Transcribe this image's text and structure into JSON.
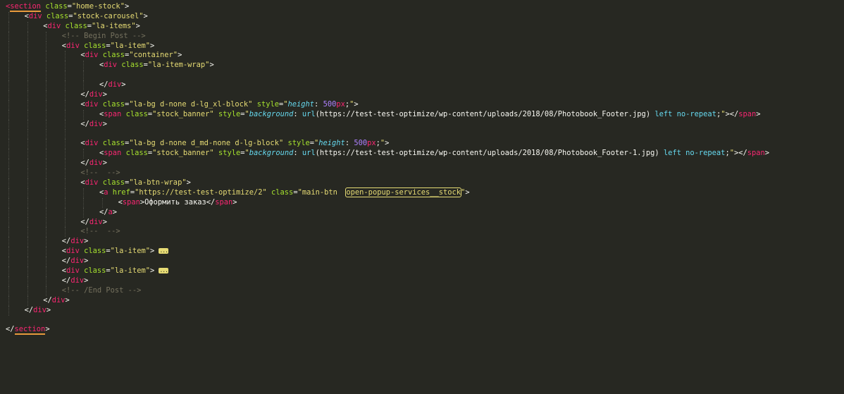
{
  "lines": [
    {
      "indent": 0,
      "tokens": [
        {
          "t": "tag",
          "v": "<"
        },
        {
          "t": "tag",
          "v": "section",
          "u": true
        },
        {
          "t": "text",
          "v": " "
        },
        {
          "t": "attr",
          "v": "class"
        },
        {
          "t": "text",
          "v": "="
        },
        {
          "t": "str",
          "v": "\"home-stock\""
        },
        {
          "t": "text",
          "v": ">"
        }
      ]
    },
    {
      "indent": 1,
      "tokens": [
        {
          "t": "text",
          "v": "<"
        },
        {
          "t": "tag",
          "v": "div"
        },
        {
          "t": "text",
          "v": " "
        },
        {
          "t": "attr",
          "v": "class"
        },
        {
          "t": "text",
          "v": "="
        },
        {
          "t": "str",
          "v": "\"stock-carousel\""
        },
        {
          "t": "text",
          "v": ">"
        }
      ]
    },
    {
      "indent": 2,
      "tokens": [
        {
          "t": "text",
          "v": "<"
        },
        {
          "t": "tag",
          "v": "div"
        },
        {
          "t": "text",
          "v": " "
        },
        {
          "t": "attr",
          "v": "class"
        },
        {
          "t": "text",
          "v": "="
        },
        {
          "t": "str",
          "v": "\"la-items\""
        },
        {
          "t": "text",
          "v": ">"
        }
      ]
    },
    {
      "indent": 3,
      "tokens": [
        {
          "t": "comment",
          "v": "<!-- Begin Post -->"
        }
      ]
    },
    {
      "indent": 3,
      "tokens": [
        {
          "t": "text",
          "v": "<"
        },
        {
          "t": "tag",
          "v": "div"
        },
        {
          "t": "text",
          "v": " "
        },
        {
          "t": "attr",
          "v": "class"
        },
        {
          "t": "text",
          "v": "="
        },
        {
          "t": "str",
          "v": "\"la-item\""
        },
        {
          "t": "text",
          "v": ">"
        }
      ]
    },
    {
      "indent": 4,
      "tokens": [
        {
          "t": "text",
          "v": "<"
        },
        {
          "t": "tag",
          "v": "div"
        },
        {
          "t": "text",
          "v": " "
        },
        {
          "t": "attr",
          "v": "class"
        },
        {
          "t": "text",
          "v": "="
        },
        {
          "t": "str",
          "v": "\"container\""
        },
        {
          "t": "text",
          "v": ">"
        }
      ]
    },
    {
      "indent": 5,
      "tokens": [
        {
          "t": "text",
          "v": "<"
        },
        {
          "t": "tag",
          "v": "div"
        },
        {
          "t": "text",
          "v": " "
        },
        {
          "t": "attr",
          "v": "class"
        },
        {
          "t": "text",
          "v": "="
        },
        {
          "t": "str",
          "v": "\"la-item-wrap\""
        },
        {
          "t": "text",
          "v": ">"
        }
      ]
    },
    {
      "indent": 5,
      "tokens": []
    },
    {
      "indent": 5,
      "tokens": [
        {
          "t": "text",
          "v": "</"
        },
        {
          "t": "tag",
          "v": "div"
        },
        {
          "t": "text",
          "v": ">"
        }
      ]
    },
    {
      "indent": 4,
      "tokens": [
        {
          "t": "text",
          "v": "</"
        },
        {
          "t": "tag",
          "v": "div"
        },
        {
          "t": "text",
          "v": ">"
        }
      ]
    },
    {
      "indent": 4,
      "tokens": [
        {
          "t": "text",
          "v": "<"
        },
        {
          "t": "tag",
          "v": "div"
        },
        {
          "t": "text",
          "v": " "
        },
        {
          "t": "attr",
          "v": "class"
        },
        {
          "t": "text",
          "v": "="
        },
        {
          "t": "str",
          "v": "\"la-bg d-none d-lg_xl-block\""
        },
        {
          "t": "text",
          "v": " "
        },
        {
          "t": "attr",
          "v": "style"
        },
        {
          "t": "text",
          "v": "="
        },
        {
          "t": "str",
          "v": "\""
        },
        {
          "t": "prop",
          "v": "height"
        },
        {
          "t": "text",
          "v": ": "
        },
        {
          "t": "num",
          "v": "500"
        },
        {
          "t": "unit",
          "v": "px"
        },
        {
          "t": "text",
          "v": ";"
        },
        {
          "t": "str",
          "v": "\""
        },
        {
          "t": "text",
          "v": ">"
        }
      ]
    },
    {
      "indent": 5,
      "tokens": [
        {
          "t": "text",
          "v": "<"
        },
        {
          "t": "tag",
          "v": "span"
        },
        {
          "t": "text",
          "v": " "
        },
        {
          "t": "attr",
          "v": "class"
        },
        {
          "t": "text",
          "v": "="
        },
        {
          "t": "str",
          "v": "\"stock_banner\""
        },
        {
          "t": "text",
          "v": " "
        },
        {
          "t": "attr",
          "v": "style"
        },
        {
          "t": "text",
          "v": "="
        },
        {
          "t": "str",
          "v": "\""
        },
        {
          "t": "prop",
          "v": "background"
        },
        {
          "t": "text",
          "v": ": "
        },
        {
          "t": "fn",
          "v": "url"
        },
        {
          "t": "text",
          "v": "(https://test-test-optimize/wp-content/uploads/2018/08/Photobook_Footer.jpg) "
        },
        {
          "t": "kw",
          "v": "left"
        },
        {
          "t": "text",
          "v": " "
        },
        {
          "t": "kw",
          "v": "no-repeat"
        },
        {
          "t": "text",
          "v": ";"
        },
        {
          "t": "str",
          "v": "\""
        },
        {
          "t": "text",
          "v": "></"
        },
        {
          "t": "tag",
          "v": "span"
        },
        {
          "t": "text",
          "v": ">"
        }
      ]
    },
    {
      "indent": 4,
      "tokens": [
        {
          "t": "text",
          "v": "</"
        },
        {
          "t": "tag",
          "v": "div"
        },
        {
          "t": "text",
          "v": ">"
        }
      ]
    },
    {
      "indent": 4,
      "tokens": []
    },
    {
      "indent": 4,
      "tokens": [
        {
          "t": "text",
          "v": "<"
        },
        {
          "t": "tag",
          "v": "div"
        },
        {
          "t": "text",
          "v": " "
        },
        {
          "t": "attr",
          "v": "class"
        },
        {
          "t": "text",
          "v": "="
        },
        {
          "t": "str",
          "v": "\"la-bg d-none d_md-none d-lg-block\""
        },
        {
          "t": "text",
          "v": " "
        },
        {
          "t": "attr",
          "v": "style"
        },
        {
          "t": "text",
          "v": "="
        },
        {
          "t": "str",
          "v": "\""
        },
        {
          "t": "prop",
          "v": "height"
        },
        {
          "t": "text",
          "v": ": "
        },
        {
          "t": "num",
          "v": "500"
        },
        {
          "t": "unit",
          "v": "px"
        },
        {
          "t": "text",
          "v": ";"
        },
        {
          "t": "str",
          "v": "\""
        },
        {
          "t": "text",
          "v": ">"
        }
      ]
    },
    {
      "indent": 5,
      "tokens": [
        {
          "t": "text",
          "v": "<"
        },
        {
          "t": "tag",
          "v": "span"
        },
        {
          "t": "text",
          "v": " "
        },
        {
          "t": "attr",
          "v": "class"
        },
        {
          "t": "text",
          "v": "="
        },
        {
          "t": "str",
          "v": "\"stock_banner\""
        },
        {
          "t": "text",
          "v": " "
        },
        {
          "t": "attr",
          "v": "style"
        },
        {
          "t": "text",
          "v": "="
        },
        {
          "t": "str",
          "v": "\""
        },
        {
          "t": "prop",
          "v": "background"
        },
        {
          "t": "text",
          "v": ": "
        },
        {
          "t": "fn",
          "v": "url"
        },
        {
          "t": "text",
          "v": "(https://test-test-optimize/wp-content/uploads/2018/08/Photobook_Footer-1.jpg) "
        },
        {
          "t": "kw",
          "v": "left"
        },
        {
          "t": "text",
          "v": " "
        },
        {
          "t": "kw",
          "v": "no-repeat"
        },
        {
          "t": "text",
          "v": ";"
        },
        {
          "t": "str",
          "v": "\""
        },
        {
          "t": "text",
          "v": "></"
        },
        {
          "t": "tag",
          "v": "span"
        },
        {
          "t": "text",
          "v": ">"
        }
      ]
    },
    {
      "indent": 4,
      "tokens": [
        {
          "t": "text",
          "v": "</"
        },
        {
          "t": "tag",
          "v": "div"
        },
        {
          "t": "text",
          "v": ">"
        }
      ]
    },
    {
      "indent": 4,
      "tokens": [
        {
          "t": "comment",
          "v": "<!--  -->"
        }
      ]
    },
    {
      "indent": 4,
      "tokens": [
        {
          "t": "text",
          "v": "<"
        },
        {
          "t": "tag",
          "v": "div"
        },
        {
          "t": "text",
          "v": " "
        },
        {
          "t": "attr",
          "v": "class"
        },
        {
          "t": "text",
          "v": "="
        },
        {
          "t": "str",
          "v": "\"la-btn-wrap\""
        },
        {
          "t": "text",
          "v": ">"
        }
      ]
    },
    {
      "indent": 5,
      "tokens": [
        {
          "t": "text",
          "v": "<"
        },
        {
          "t": "tag",
          "v": "a"
        },
        {
          "t": "text",
          "v": " "
        },
        {
          "t": "attr",
          "v": "href"
        },
        {
          "t": "text",
          "v": "="
        },
        {
          "t": "str",
          "v": "\"https://test-test-optimize/2\""
        },
        {
          "t": "text",
          "v": " "
        },
        {
          "t": "attr",
          "v": "class"
        },
        {
          "t": "text",
          "v": "="
        },
        {
          "t": "str",
          "v": "\"main-btn  "
        },
        {
          "t": "boxed",
          "v": "open-popup-services__stock"
        },
        {
          "t": "str",
          "v": "\""
        },
        {
          "t": "text",
          "v": ">"
        }
      ]
    },
    {
      "indent": 6,
      "tokens": [
        {
          "t": "text",
          "v": "<"
        },
        {
          "t": "tag",
          "v": "span"
        },
        {
          "t": "text",
          "v": ">Оформить заказ</"
        },
        {
          "t": "tag",
          "v": "span"
        },
        {
          "t": "text",
          "v": ">"
        }
      ]
    },
    {
      "indent": 5,
      "tokens": [
        {
          "t": "text",
          "v": "</"
        },
        {
          "t": "tag",
          "v": "a"
        },
        {
          "t": "text",
          "v": ">"
        }
      ]
    },
    {
      "indent": 4,
      "tokens": [
        {
          "t": "text",
          "v": "</"
        },
        {
          "t": "tag",
          "v": "div"
        },
        {
          "t": "text",
          "v": ">"
        }
      ]
    },
    {
      "indent": 4,
      "tokens": [
        {
          "t": "comment",
          "v": "<!--  -->"
        }
      ]
    },
    {
      "indent": 3,
      "tokens": [
        {
          "t": "text",
          "v": "</"
        },
        {
          "t": "tag",
          "v": "div"
        },
        {
          "t": "text",
          "v": ">"
        }
      ]
    },
    {
      "indent": 3,
      "tokens": [
        {
          "t": "text",
          "v": "<"
        },
        {
          "t": "tag",
          "v": "div"
        },
        {
          "t": "text",
          "v": " "
        },
        {
          "t": "attr",
          "v": "class"
        },
        {
          "t": "text",
          "v": "="
        },
        {
          "t": "str",
          "v": "\"la-item\""
        },
        {
          "t": "text",
          "v": "> "
        },
        {
          "t": "fold",
          "v": "..."
        }
      ]
    },
    {
      "indent": 3,
      "tokens": [
        {
          "t": "text",
          "v": "</"
        },
        {
          "t": "tag",
          "v": "div"
        },
        {
          "t": "text",
          "v": ">"
        }
      ]
    },
    {
      "indent": 3,
      "tokens": [
        {
          "t": "text",
          "v": "<"
        },
        {
          "t": "tag",
          "v": "div"
        },
        {
          "t": "text",
          "v": " "
        },
        {
          "t": "attr",
          "v": "class"
        },
        {
          "t": "text",
          "v": "="
        },
        {
          "t": "str",
          "v": "\"la-item\""
        },
        {
          "t": "text",
          "v": "> "
        },
        {
          "t": "fold",
          "v": "..."
        }
      ]
    },
    {
      "indent": 3,
      "tokens": [
        {
          "t": "text",
          "v": "</"
        },
        {
          "t": "tag",
          "v": "div"
        },
        {
          "t": "text",
          "v": ">"
        }
      ]
    },
    {
      "indent": 3,
      "tokens": [
        {
          "t": "comment",
          "v": "<!-- /End Post -->"
        }
      ]
    },
    {
      "indent": 2,
      "tokens": [
        {
          "t": "text",
          "v": "</"
        },
        {
          "t": "tag",
          "v": "div"
        },
        {
          "t": "text",
          "v": ">"
        }
      ]
    },
    {
      "indent": 1,
      "tokens": [
        {
          "t": "text",
          "v": "</"
        },
        {
          "t": "tag",
          "v": "div"
        },
        {
          "t": "text",
          "v": ">"
        }
      ]
    },
    {
      "indent": 0,
      "tokens": []
    },
    {
      "indent": 0,
      "tokens": [
        {
          "t": "text",
          "v": "</"
        },
        {
          "t": "tag",
          "v": "section",
          "u": true
        },
        {
          "t": "text",
          "v": ">"
        }
      ]
    }
  ],
  "colors": {
    "background": "#272822",
    "tag": "#f92672",
    "attribute": "#a6e22e",
    "string": "#e6db74",
    "comment": "#75715e",
    "property": "#66d9ef",
    "number": "#ae81ff",
    "match-underline": "#e89a3c"
  }
}
